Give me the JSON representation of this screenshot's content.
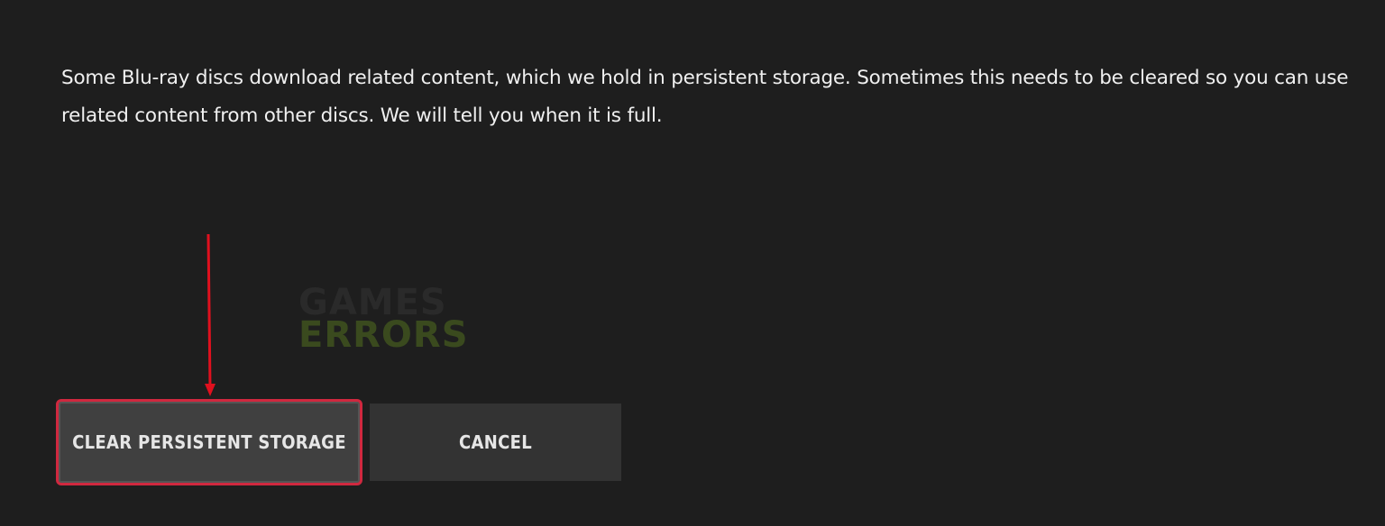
{
  "dialog": {
    "message": "Some Blu-ray discs download related content, which we hold in persistent storage.  Sometimes this needs to be cleared so you can use related content from other discs. We will tell you when it is full."
  },
  "watermark": {
    "line1": "GAMES",
    "line2": "ERRORS"
  },
  "buttons": {
    "clear_label": "CLEAR PERSISTENT STORAGE",
    "cancel_label": "CANCEL"
  },
  "annotation": {
    "arrow_color": "#e0101e"
  },
  "colors": {
    "background": "#1e1e1e",
    "focus_border": "#d0283f"
  }
}
